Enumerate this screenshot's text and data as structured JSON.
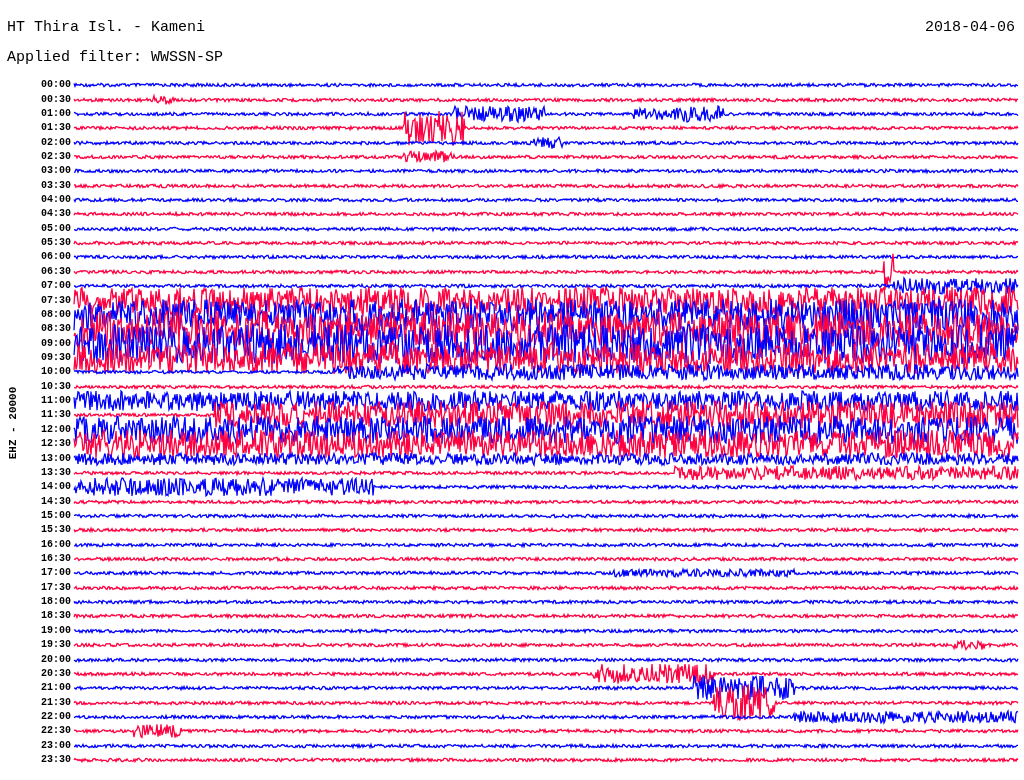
{
  "header": {
    "station": "HT Thira Isl. - Kameni",
    "date": "2018-04-06",
    "filter": "Applied filter: WWSSN-SP"
  },
  "axis_label": "EHZ - 20000",
  "rows": [
    {
      "time": "00:00",
      "color": "#0000ff"
    },
    {
      "time": "00:30",
      "color": "#ff0040"
    },
    {
      "time": "01:00",
      "color": "#0000ff"
    },
    {
      "time": "01:30",
      "color": "#ff0040"
    },
    {
      "time": "02:00",
      "color": "#0000ff"
    },
    {
      "time": "02:30",
      "color": "#ff0040"
    },
    {
      "time": "03:00",
      "color": "#0000ff"
    },
    {
      "time": "03:30",
      "color": "#ff0040"
    },
    {
      "time": "04:00",
      "color": "#0000ff"
    },
    {
      "time": "04:30",
      "color": "#ff0040"
    },
    {
      "time": "05:00",
      "color": "#0000ff"
    },
    {
      "time": "05:30",
      "color": "#ff0040"
    },
    {
      "time": "06:00",
      "color": "#0000ff"
    },
    {
      "time": "06:30",
      "color": "#ff0040"
    },
    {
      "time": "07:00",
      "color": "#0000ff"
    },
    {
      "time": "07:30",
      "color": "#ff0040"
    },
    {
      "time": "08:00",
      "color": "#0000ff"
    },
    {
      "time": "08:30",
      "color": "#ff0040"
    },
    {
      "time": "09:00",
      "color": "#0000ff"
    },
    {
      "time": "09:30",
      "color": "#ff0040"
    },
    {
      "time": "10:00",
      "color": "#0000ff"
    },
    {
      "time": "10:30",
      "color": "#ff0040"
    },
    {
      "time": "11:00",
      "color": "#0000ff"
    },
    {
      "time": "11:30",
      "color": "#ff0040"
    },
    {
      "time": "12:00",
      "color": "#0000ff"
    },
    {
      "time": "12:30",
      "color": "#ff0040"
    },
    {
      "time": "13:00",
      "color": "#0000ff"
    },
    {
      "time": "13:30",
      "color": "#ff0040"
    },
    {
      "time": "14:00",
      "color": "#0000ff"
    },
    {
      "time": "14:30",
      "color": "#ff0040"
    },
    {
      "time": "15:00",
      "color": "#0000ff"
    },
    {
      "time": "15:30",
      "color": "#ff0040"
    },
    {
      "time": "16:00",
      "color": "#0000ff"
    },
    {
      "time": "16:30",
      "color": "#ff0040"
    },
    {
      "time": "17:00",
      "color": "#0000ff"
    },
    {
      "time": "17:30",
      "color": "#ff0040"
    },
    {
      "time": "18:00",
      "color": "#0000ff"
    },
    {
      "time": "18:30",
      "color": "#ff0040"
    },
    {
      "time": "19:00",
      "color": "#0000ff"
    },
    {
      "time": "19:30",
      "color": "#ff0040"
    },
    {
      "time": "20:00",
      "color": "#0000ff"
    },
    {
      "time": "20:30",
      "color": "#ff0040"
    },
    {
      "time": "21:00",
      "color": "#0000ff"
    },
    {
      "time": "21:30",
      "color": "#ff0040"
    },
    {
      "time": "22:00",
      "color": "#0000ff"
    },
    {
      "time": "22:30",
      "color": "#ff0040"
    },
    {
      "time": "23:00",
      "color": "#0000ff"
    },
    {
      "time": "23:30",
      "color": "#ff0040"
    }
  ]
}
